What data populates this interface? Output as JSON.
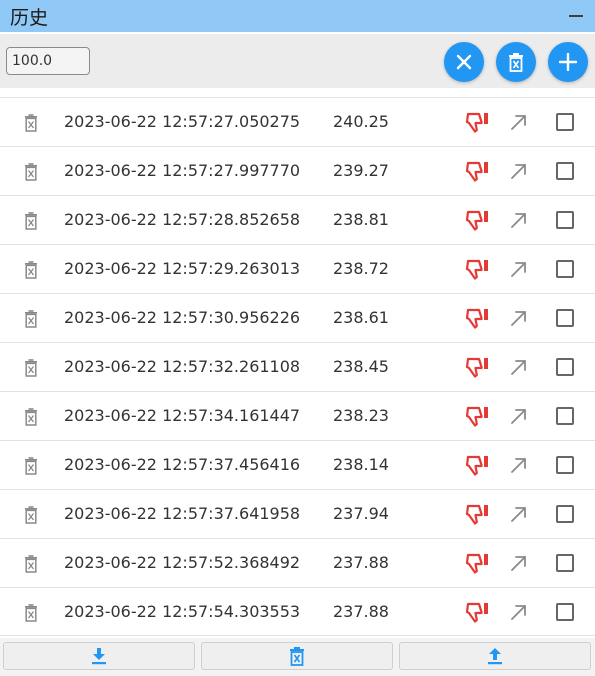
{
  "window": {
    "title": "历史"
  },
  "toolbar": {
    "value_input": "100.0",
    "buttons": [
      "close-icon",
      "delete-icon",
      "add-icon"
    ]
  },
  "colors": {
    "titlebar": "#90c8f6",
    "accent": "#2196f3",
    "dislike": "#e53935"
  },
  "history": [
    {
      "time": "2023-06-22 12:57:27.050275",
      "value": "240.25"
    },
    {
      "time": "2023-06-22 12:57:27.997770",
      "value": "239.27"
    },
    {
      "time": "2023-06-22 12:57:28.852658",
      "value": "238.81"
    },
    {
      "time": "2023-06-22 12:57:29.263013",
      "value": "238.72"
    },
    {
      "time": "2023-06-22 12:57:30.956226",
      "value": "238.61"
    },
    {
      "time": "2023-06-22 12:57:32.261108",
      "value": "238.45"
    },
    {
      "time": "2023-06-22 12:57:34.161447",
      "value": "238.23"
    },
    {
      "time": "2023-06-22 12:57:37.456416",
      "value": "238.14"
    },
    {
      "time": "2023-06-22 12:57:37.641958",
      "value": "237.94"
    },
    {
      "time": "2023-06-22 12:57:52.368492",
      "value": "237.88"
    },
    {
      "time": "2023-06-22 12:57:54.303553",
      "value": "237.88"
    }
  ],
  "footer": {
    "buttons": [
      "download-icon",
      "trash-icon",
      "upload-icon"
    ]
  }
}
